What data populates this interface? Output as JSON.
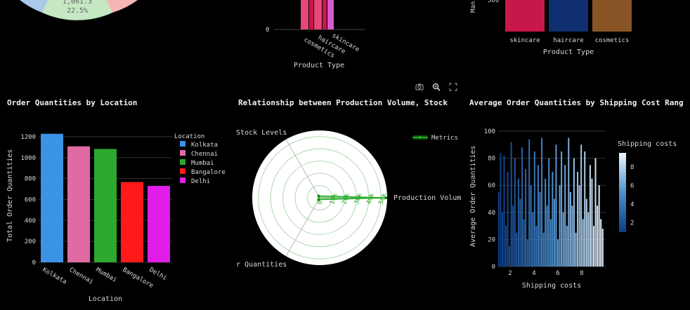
{
  "top": {
    "pie": {
      "slice_value": "1,061.3",
      "slice_percent": "22.5%",
      "colors": [
        "#c5e8c2",
        "#a9c8ea",
        "#f4b6b4"
      ]
    },
    "product_bars": {
      "xlabel": "Product Type",
      "y_tick": "0",
      "categories": [
        "cosmetics",
        "haircare",
        "skincare"
      ]
    },
    "manuf_bars": {
      "ylabel": "Man",
      "y_tick": "500",
      "categories": [
        "skincare",
        "haircare",
        "cosmetics"
      ],
      "colors": [
        "#c8174a",
        "#0f2f70",
        "#8a5526"
      ],
      "xlabel": "Product Type"
    }
  },
  "toolbar": {
    "camera_icon": "camera-icon",
    "zoom_icon": "zoom-icon",
    "autoscale_icon": "autoscale-icon"
  },
  "chart_data": [
    {
      "type": "bar",
      "title": "Order Quantities by Location",
      "categories": [
        "Kolkata",
        "Chennai",
        "Mumbai",
        "Bangalore",
        "Delhi"
      ],
      "values": [
        1228,
        1108,
        1083,
        767,
        730
      ],
      "colors": [
        "#3b93e6",
        "#e06aa3",
        "#2ea82e",
        "#ff1a1a",
        "#e01ee8"
      ],
      "xlabel": "Location",
      "ylabel": "Total Order Quantities",
      "ylim": [
        0,
        1300
      ],
      "yticks": [
        0,
        200,
        400,
        600,
        800,
        1000,
        1200
      ],
      "legend_title": "Location",
      "legend": [
        "Kolkata",
        "Chennai",
        "Mumbai",
        "Bangalore",
        "Delhi"
      ]
    },
    {
      "type": "radar",
      "title": "Relationship between Production Volume, Stock",
      "axes": [
        "Production Volum",
        "Stock Levels",
        "r Quantities"
      ],
      "radial_ticks": [
        "0",
        "10k",
        "20k",
        "30k",
        "40k",
        "50k"
      ],
      "values": [
        54000,
        380,
        560
      ],
      "series_name": "Metrics",
      "color": "#22aa22"
    },
    {
      "type": "bar",
      "title": "Average Order Quantities by Shipping Cost Rang",
      "xlabel": "Shipping costs",
      "ylabel": "Average Order Quantities",
      "xlim": [
        1,
        10
      ],
      "ylim": [
        0,
        100
      ],
      "xticks": [
        2,
        4,
        6,
        8
      ],
      "yticks": [
        0,
        20,
        40,
        60,
        80,
        100
      ],
      "colorbar_title": "Shipping costs",
      "colorbar_ticks": [
        2,
        4,
        6,
        8
      ],
      "x": [
        1.05,
        1.2,
        1.35,
        1.5,
        1.65,
        1.8,
        1.95,
        2.1,
        2.25,
        2.4,
        2.55,
        2.7,
        2.85,
        3.0,
        3.15,
        3.3,
        3.45,
        3.6,
        3.75,
        3.9,
        4.05,
        4.2,
        4.35,
        4.5,
        4.65,
        4.8,
        4.95,
        5.1,
        5.25,
        5.4,
        5.55,
        5.7,
        5.85,
        6.0,
        6.15,
        6.3,
        6.45,
        6.6,
        6.75,
        6.9,
        7.05,
        7.2,
        7.35,
        7.5,
        7.65,
        7.8,
        7.95,
        8.1,
        8.25,
        8.4,
        8.55,
        8.7,
        8.85,
        9.0,
        9.15,
        9.3,
        9.45,
        9.6,
        9.75
      ],
      "values": [
        55,
        84,
        40,
        82,
        30,
        70,
        15,
        92,
        45,
        80,
        25,
        65,
        50,
        88,
        35,
        72,
        20,
        94,
        60,
        40,
        85,
        30,
        75,
        55,
        95,
        25,
        65,
        45,
        80,
        35,
        70,
        50,
        90,
        20,
        60,
        85,
        40,
        75,
        30,
        95,
        55,
        45,
        80,
        25,
        70,
        60,
        90,
        35,
        85,
        50,
        40,
        75,
        65,
        30,
        80,
        45,
        60,
        35,
        28
      ]
    }
  ]
}
